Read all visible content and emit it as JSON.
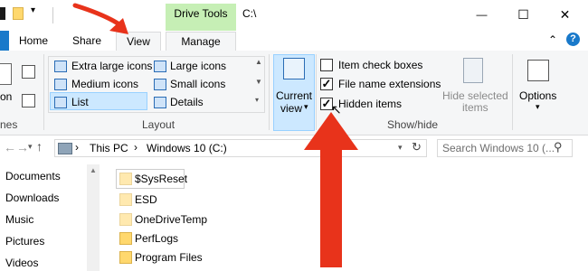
{
  "window": {
    "context_tab_label": "Drive Tools",
    "path_title": "C:\\",
    "minimize_glyph": "—",
    "maximize_glyph": "☐",
    "close_glyph": "✕"
  },
  "tabs": {
    "home": "Home",
    "share": "Share",
    "view": "View",
    "manage": "Manage"
  },
  "ribbon": {
    "pane_partial": "on",
    "panes_partial": "nes",
    "layout": {
      "items": [
        "Extra large icons",
        "Large icons",
        "Medium icons",
        "Small icons",
        "List",
        "Details"
      ],
      "group_label": "Layout"
    },
    "current_view_line1": "Current",
    "current_view_line2": "view",
    "show_hide": {
      "item_check_boxes": "Item check boxes",
      "file_name_extensions": "File name extensions",
      "hidden_items": "Hidden items",
      "hide_selected_line1": "Hide selected",
      "hide_selected_line2": "items",
      "group_label": "Show/hide",
      "item_check_boxes_checked": false,
      "file_name_extensions_checked": true,
      "hidden_items_checked": true
    },
    "options_label": "Options"
  },
  "address": {
    "segments": [
      "This PC",
      "Windows 10 (C:)"
    ],
    "search_placeholder": "Search Windows 10 (..."
  },
  "nav_pane": {
    "items": [
      "Documents",
      "Downloads",
      "Music",
      "Pictures",
      "Videos"
    ]
  },
  "files": [
    "$SysReset",
    "ESD",
    "OneDriveTemp",
    "PerfLogs",
    "Program Files"
  ],
  "colors": {
    "accent_blue": "#1979ca",
    "drive_tools_green": "#c6efb5",
    "arrow_red": "#e8331b",
    "folder_yellow": "#ffd86e"
  }
}
